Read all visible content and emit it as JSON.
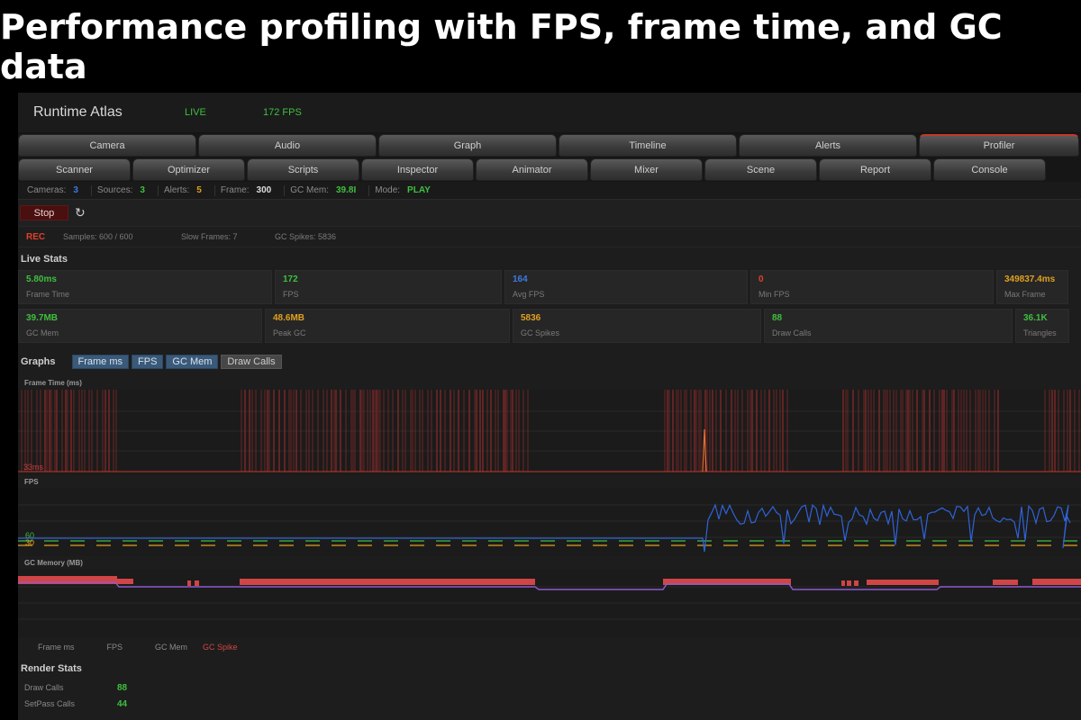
{
  "banner": {
    "title": "Performance profiling with FPS, frame time, and GC data"
  },
  "titlebar": {
    "app_title": "Runtime Atlas",
    "status": "LIVE",
    "fps": "172 FPS"
  },
  "tabs_row1": [
    {
      "label": "Camera"
    },
    {
      "label": "Audio"
    },
    {
      "label": "Graph"
    },
    {
      "label": "Timeline"
    },
    {
      "label": "Alerts"
    },
    {
      "label": "Profiler",
      "active": true
    }
  ],
  "tabs_row2": [
    {
      "label": "Scanner"
    },
    {
      "label": "Optimizer"
    },
    {
      "label": "Scripts"
    },
    {
      "label": "Inspector"
    },
    {
      "label": "Animator"
    },
    {
      "label": "Mixer"
    },
    {
      "label": "Scene"
    },
    {
      "label": "Report"
    },
    {
      "label": "Console"
    }
  ],
  "statusline": {
    "cameras_label": "Cameras:",
    "cameras": "3",
    "sources_label": "Sources:",
    "sources": "3",
    "alerts_label": "Alerts:",
    "alerts": "5",
    "frame_label": "Frame:",
    "frame": "300",
    "gcmem_label": "GC Mem:",
    "gcmem": "39.8I",
    "mode_label": "Mode:",
    "mode": "PLAY"
  },
  "controls": {
    "stop_label": "Stop",
    "refresh_icon": "refresh-icon"
  },
  "recording": {
    "rec": "REC",
    "samples": "Samples: 600 / 600",
    "slow_frames": "Slow Frames: 7",
    "gc_spikes": "GC Spikes: 5836"
  },
  "live_stats": {
    "title": "Live Stats",
    "row1": [
      {
        "value": "5.80ms",
        "label": "Frame Time",
        "color": "green"
      },
      {
        "value": "172",
        "label": "FPS",
        "color": "green"
      },
      {
        "value": "164",
        "label": "Avg FPS",
        "color": "blue"
      },
      {
        "value": "0",
        "label": "Min FPS",
        "color": "red"
      },
      {
        "value": "349837.4ms",
        "label": "Max Frame",
        "color": "orange"
      }
    ],
    "row2": [
      {
        "value": "39.7MB",
        "label": "GC Mem",
        "color": "green"
      },
      {
        "value": "48.6MB",
        "label": "Peak GC",
        "color": "orange"
      },
      {
        "value": "5836",
        "label": "GC Spikes",
        "color": "orange"
      },
      {
        "value": "88",
        "label": "Draw Calls",
        "color": "green"
      },
      {
        "value": "36.1K",
        "label": "Triangles",
        "color": "green"
      }
    ]
  },
  "graphs": {
    "title": "Graphs",
    "buttons": [
      {
        "label": "Frame ms",
        "on": true
      },
      {
        "label": "FPS",
        "on": true
      },
      {
        "label": "GC Mem",
        "on": true
      },
      {
        "label": "Draw Calls",
        "on": false
      }
    ],
    "frame_time_label": "Frame Time (ms)",
    "frame_time_marker": "33ms",
    "fps_label": "FPS",
    "fps_marker_60": "60",
    "fps_marker_30": "30",
    "gc_label": "GC Memory (MB)",
    "legend": [
      "Frame ms",
      "FPS",
      "GC Mem",
      "GC Spike"
    ]
  },
  "render_stats": {
    "title": "Render Stats",
    "rows": [
      {
        "label": "Draw Calls",
        "value": "88"
      },
      {
        "label": "SetPass Calls",
        "value": "44"
      }
    ]
  },
  "colors": {
    "accent_blue": "#3b7be0",
    "green": "#3fbf3f",
    "orange": "#e0a020",
    "red": "#e0402a",
    "spike": "#d04545",
    "gc_line": "#9b59d0"
  }
}
